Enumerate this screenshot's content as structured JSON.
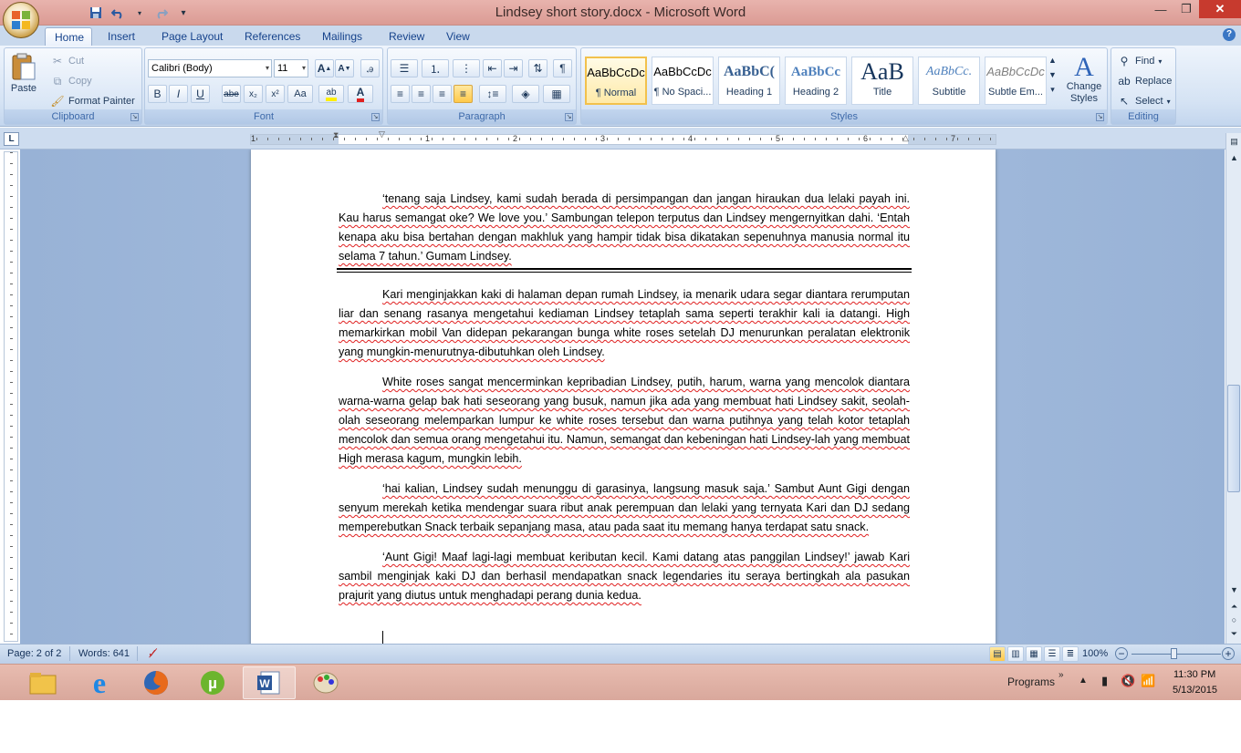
{
  "window": {
    "title": "Lindsey short story.docx - Microsoft Word"
  },
  "qat": {
    "save": "save-icon",
    "undo": "undo-icon",
    "redo": "redo-icon"
  },
  "tabs": [
    "Home",
    "Insert",
    "Page Layout",
    "References",
    "Mailings",
    "Review",
    "View"
  ],
  "clipboard": {
    "paste": "Paste",
    "cut": "Cut",
    "copy": "Copy",
    "format_painter": "Format Painter",
    "label": "Clipboard"
  },
  "font": {
    "name": "Calibri (Body)",
    "size": "11",
    "label": "Font",
    "bold": "B",
    "italic": "I",
    "underline": "U",
    "strike": "abe",
    "case": "Aa"
  },
  "paragraph": {
    "label": "Paragraph"
  },
  "styles": {
    "label": "Styles",
    "items": [
      {
        "preview": "AaBbCcDc",
        "name": "¶ Normal"
      },
      {
        "preview": "AaBbCcDc",
        "name": "¶ No Spaci..."
      },
      {
        "preview": "AaBbC(",
        "name": "Heading 1"
      },
      {
        "preview": "AaBbCc",
        "name": "Heading 2"
      },
      {
        "preview": "AaB",
        "name": "Title"
      },
      {
        "preview": "AaBbCc.",
        "name": "Subtitle"
      },
      {
        "preview": "AaBbCcDc",
        "name": "Subtle Em..."
      }
    ],
    "change_styles": "Change Styles"
  },
  "editing": {
    "find": "Find",
    "replace": "Replace",
    "select": "Select",
    "label": "Editing"
  },
  "ruler": {
    "numbers": [
      "1",
      "1",
      "2",
      "3",
      "4",
      "5",
      "6",
      "7"
    ]
  },
  "document": {
    "p1": "‘tenang saja Lindsey, kami sudah berada di persimpangan dan jangan hiraukan dua lelaki payah ini. Kau harus semangat oke? We love you.’ Sambungan telepon terputus dan Lindsey mengernyitkan dahi. ‘Entah kenapa aku bisa bertahan dengan makhluk yang hampir tidak bisa dikatakan sepenuhnya manusia normal itu selama 7 tahun.’ Gumam Lindsey.",
    "p2": "Kari menginjakkan kaki di halaman depan rumah Lindsey, ia menarik udara segar diantara rerumputan liar dan senang rasanya mengetahui kediaman Lindsey tetaplah sama seperti terakhir kali ia datangi. High memarkirkan mobil Van didepan pekarangan bunga white roses setelah DJ menurunkan peralatan elektronik yang mungkin-menurutnya-dibutuhkan oleh Lindsey.",
    "p3": "White roses sangat mencerminkan kepribadian Lindsey, putih, harum, warna yang mencolok diantara warna-warna gelap bak hati seseorang yang busuk, namun jika ada yang membuat hati Lindsey sakit, seolah-olah seseorang melemparkan lumpur ke white roses tersebut dan warna putihnya yang telah kotor tetaplah mencolok dan semua orang mengetahui itu. Namun, semangat dan kebeningan hati Lindsey-lah yang membuat High merasa kagum, mungkin lebih.",
    "p4": "‘hai kalian, Lindsey sudah menunggu di garasinya, langsung masuk saja.’ Sambut Aunt Gigi dengan senyum merekah ketika mendengar suara ribut anak perempuan dan lelaki yang ternyata Kari dan DJ sedang memperebutkan Snack terbaik sepanjang masa, atau pada saat itu memang hanya terdapat satu snack.",
    "p5": "‘Aunt Gigi! Maaf lagi-lagi membuat keributan kecil. Kami datang atas panggilan Lindsey!’ jawab Kari sambil menginjak kaki DJ dan berhasil mendapatkan snack legendaries itu seraya bertingkah ala pasukan prajurit yang diutus untuk menghadapi perang dunia kedua."
  },
  "status": {
    "page": "Page: 2 of 2",
    "words": "Words: 641",
    "zoom": "100%"
  },
  "taskbar": {
    "apps": [
      "file-explorer-icon",
      "internet-explorer-icon",
      "firefox-icon",
      "utorrent-icon",
      "word-icon",
      "paint-icon"
    ],
    "programs": "Programs",
    "time": "11:30 PM",
    "date": "5/13/2015"
  },
  "colors": {
    "titlebar": "#db9b94",
    "ribbon": "#d5e3f4",
    "workspace": "#a8c0e0",
    "taskbar": "#d9a89c",
    "close": "#c73a2e"
  }
}
